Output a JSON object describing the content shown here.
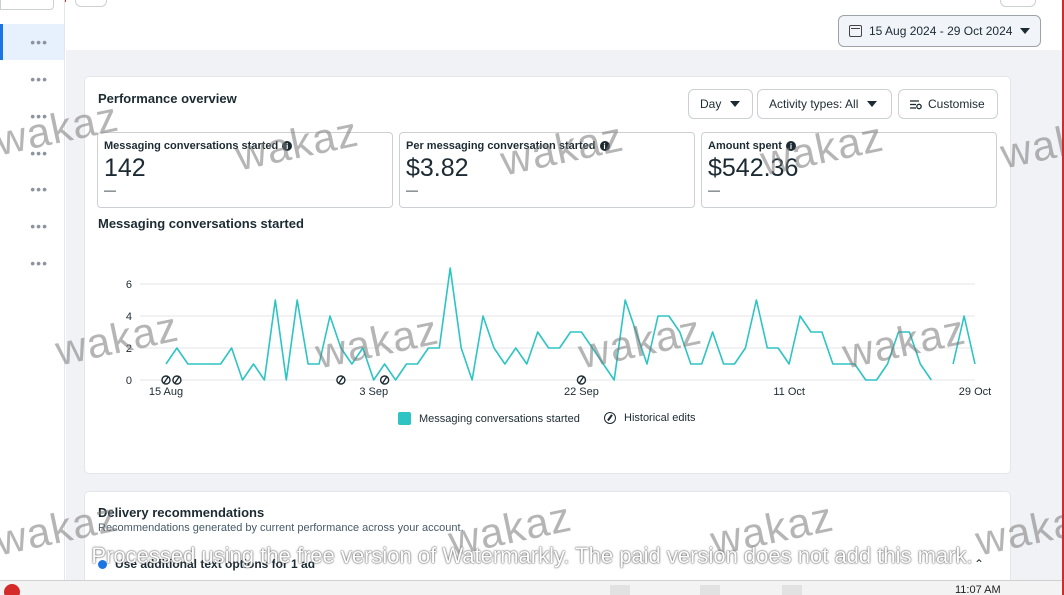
{
  "date_range": {
    "label": "15 Aug 2024 - 29 Oct 2024",
    "icon": "calendar-icon"
  },
  "left_rail": {
    "items": [
      "•••",
      "•••",
      "•••",
      "•••",
      "•••",
      "•••",
      "•••"
    ]
  },
  "performance": {
    "title": "Performance overview",
    "controls": {
      "granularity": "Day",
      "activity": "Activity types: All",
      "customise": "Customise"
    },
    "metrics": [
      {
        "label": "Messaging conversations started",
        "value": "142",
        "change": "—"
      },
      {
        "label": "Per messaging conversation started",
        "value": "$3.82",
        "change": "—"
      },
      {
        "label": "Amount spent",
        "value": "$542.36",
        "change": "—"
      }
    ],
    "chart_title": "Messaging conversations started",
    "legend": {
      "series": "Messaging conversations started",
      "edits": "Historical edits"
    }
  },
  "chart_data": {
    "type": "line",
    "title": "Messaging conversations started",
    "x_ticks": [
      "15 Aug",
      "3 Sep",
      "22 Sep",
      "11 Oct",
      "29 Oct"
    ],
    "y_ticks": [
      "0",
      "2",
      "4",
      "6"
    ],
    "ylim": [
      0,
      7
    ],
    "grid": true,
    "legend_position": "bottom",
    "series": [
      {
        "name": "Messaging conversations started",
        "color": "#2ec4c4",
        "values": [
          1,
          2,
          1,
          1,
          1,
          1,
          2,
          0,
          1,
          0,
          5,
          0,
          5,
          1,
          1,
          4,
          2,
          1,
          2,
          0,
          1,
          0,
          1,
          1,
          2,
          2,
          7,
          2,
          0,
          4,
          2,
          1,
          2,
          1,
          3,
          2,
          2,
          3,
          3,
          2,
          1,
          0,
          5,
          3,
          1,
          4,
          4,
          3,
          1,
          1,
          3,
          1,
          1,
          2,
          5,
          2,
          2,
          1,
          4,
          3,
          3,
          1,
          1,
          1,
          0,
          0,
          1,
          3,
          3,
          1,
          0,
          null,
          1,
          4,
          1
        ]
      }
    ],
    "historical_edits": [
      "15 Aug",
      "16 Aug",
      "31 Aug",
      "4 Sep",
      "22 Sep"
    ]
  },
  "delivery": {
    "title": "Delivery recommendations",
    "subtitle": "Recommendations generated by current performance across your account.",
    "item": "Use additional text options for 1 ad"
  },
  "watermark": {
    "text": "wakaz",
    "banner": "Processed using the free version of Watermarkly. The paid version does not add this mark."
  },
  "taskbar": {
    "time": "11:07 AM"
  }
}
